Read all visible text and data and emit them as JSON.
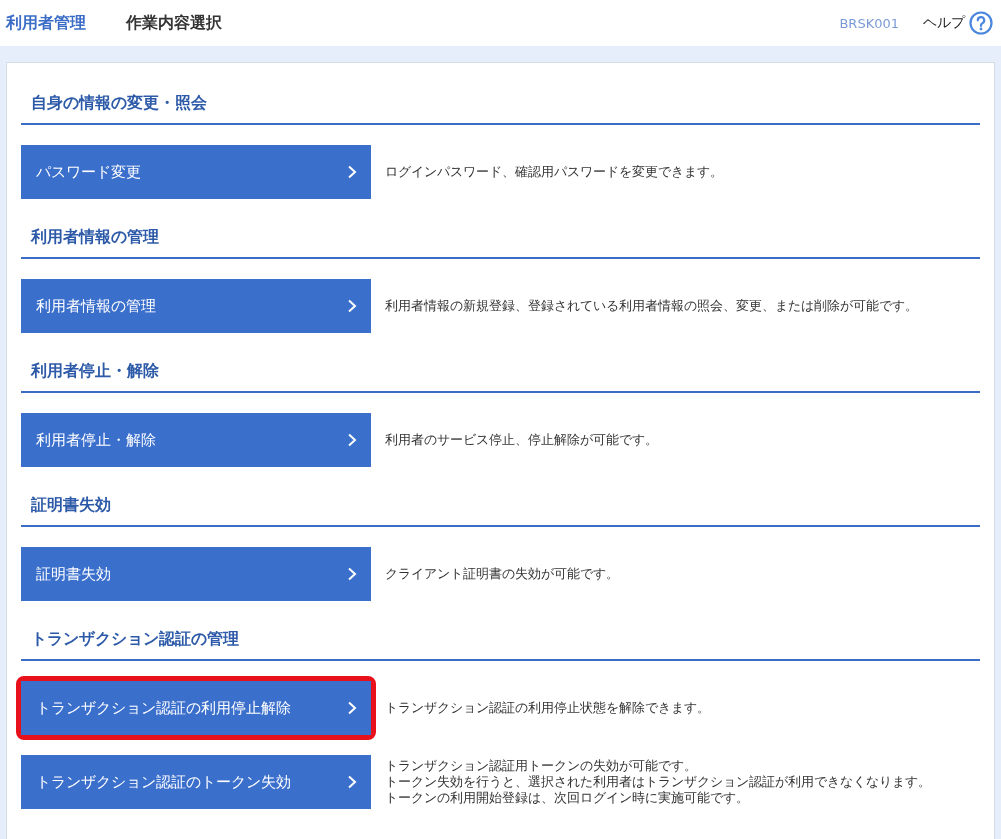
{
  "header": {
    "app_title": "利用者管理",
    "page_title": "作業内容選択",
    "screen_id": "BRSK001",
    "help": "ヘルプ"
  },
  "sections": [
    {
      "title": "自身の情報の変更・照会",
      "items": [
        {
          "label": "パスワード変更",
          "highlighted": false,
          "description": [
            "ログインパスワード、確認用パスワードを変更できます。"
          ]
        }
      ]
    },
    {
      "title": "利用者情報の管理",
      "items": [
        {
          "label": "利用者情報の管理",
          "highlighted": false,
          "description": [
            "利用者情報の新規登録、登録されている利用者情報の照会、変更、または削除が可能です。"
          ]
        }
      ]
    },
    {
      "title": "利用者停止・解除",
      "items": [
        {
          "label": "利用者停止・解除",
          "highlighted": false,
          "description": [
            "利用者のサービス停止、停止解除が可能です。"
          ]
        }
      ]
    },
    {
      "title": "証明書失効",
      "items": [
        {
          "label": "証明書失効",
          "highlighted": false,
          "description": [
            "クライアント証明書の失効が可能です。"
          ]
        }
      ]
    },
    {
      "title": "トランザクション認証の管理",
      "items": [
        {
          "label": "トランザクション認証の利用停止解除",
          "highlighted": true,
          "description": [
            "トランザクション認証の利用停止状態を解除できます。"
          ]
        },
        {
          "label": "トランザクション認証のトークン失効",
          "highlighted": false,
          "description": [
            "トランザクション認証用トークンの失効が可能です。",
            "トークン失効を行うと、選択された利用者はトランザクション認証が利用できなくなります。",
            "トークンの利用開始登録は、次回ログイン時に実施可能です。"
          ]
        }
      ]
    }
  ]
}
